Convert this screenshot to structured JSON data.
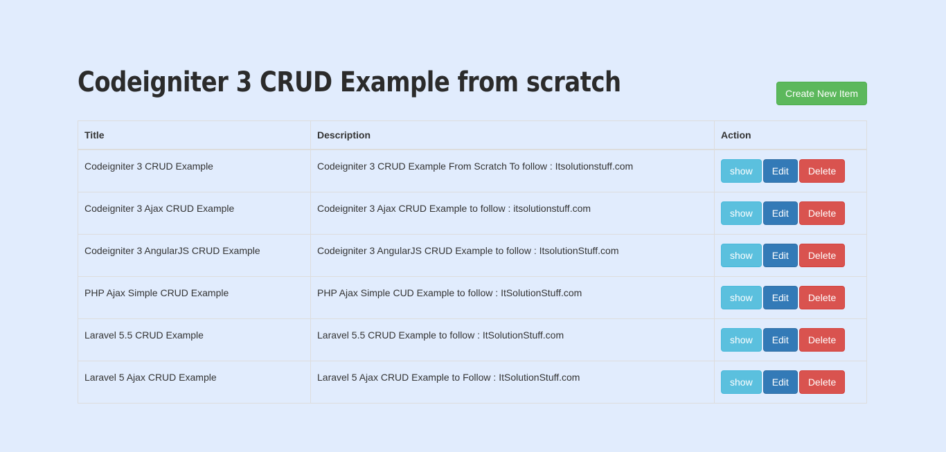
{
  "header": {
    "title": "Codeigniter 3 CRUD Example from scratch",
    "create_button_label": "Create New Item"
  },
  "colors": {
    "page_background": "#e1ecfd",
    "create_button": "#5cb85c",
    "show_button": "#5bc0de",
    "edit_button": "#337ab7",
    "delete_button": "#d9534f",
    "table_border": "#dddddd",
    "text": "#333333"
  },
  "table": {
    "columns": [
      {
        "key": "title",
        "label": "Title"
      },
      {
        "key": "description",
        "label": "Description"
      },
      {
        "key": "action",
        "label": "Action"
      }
    ],
    "action_labels": {
      "show": "show",
      "edit": "Edit",
      "delete": "Delete"
    },
    "rows": [
      {
        "title": "Codeigniter 3 CRUD Example",
        "description": "Codeigniter 3 CRUD Example From Scratch To follow : Itsolutionstuff.com"
      },
      {
        "title": "Codeigniter 3 Ajax CRUD Example",
        "description": "Codeigniter 3 Ajax CRUD Example to follow : itsolutionstuff.com"
      },
      {
        "title": "Codeigniter 3 AngularJS CRUD Example",
        "description": "Codeigniter 3 AngularJS CRUD Example to follow : ItsolutionStuff.com"
      },
      {
        "title": "PHP Ajax Simple CRUD Example",
        "description": "PHP Ajax Simple CUD Example to follow : ItSolutionStuff.com"
      },
      {
        "title": "Laravel 5.5 CRUD Example",
        "description": "Laravel 5.5 CRUD Example to follow : ItSolutionStuff.com"
      },
      {
        "title": "Laravel 5 Ajax CRUD Example",
        "description": "Laravel 5 Ajax CRUD Example to Follow : ItSolutionStuff.com"
      }
    ]
  }
}
